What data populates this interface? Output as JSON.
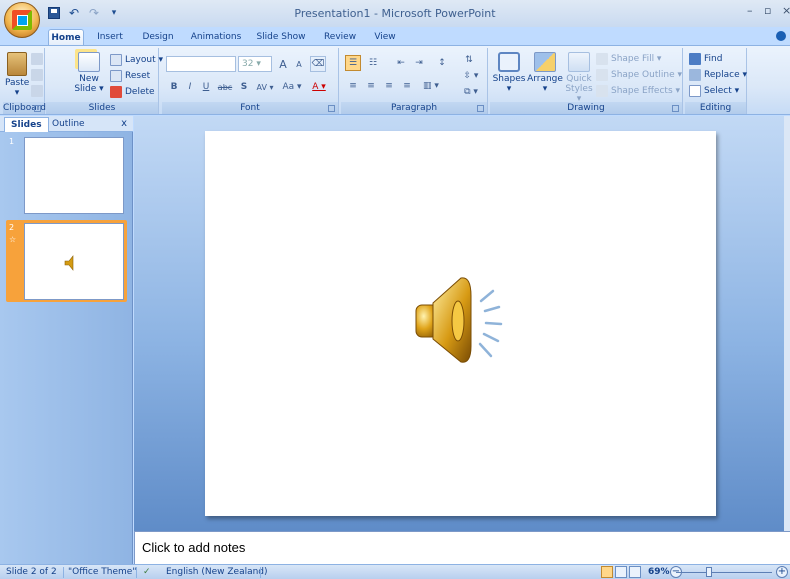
{
  "window": {
    "title": "Presentation1 - Microsoft PowerPoint",
    "minimize": "–",
    "maximize": "▫",
    "close": "×"
  },
  "quick_access": {
    "undo": "↶",
    "redo": "↷",
    "dropdown": "▾"
  },
  "tabs": [
    "Home",
    "Insert",
    "Design",
    "Animations",
    "Slide Show",
    "Review",
    "View"
  ],
  "active_tab": "Home",
  "ribbon": {
    "clipboard": {
      "label": "Clipboard",
      "paste": "Paste",
      "paste_arrow": "▾"
    },
    "slides": {
      "label": "Slides",
      "new_slide": "New",
      "new_slide_2": "Slide ▾",
      "layout": "Layout ▾",
      "reset": "Reset",
      "delete": "Delete"
    },
    "font": {
      "label": "Font",
      "font_size": "32",
      "grow": "A",
      "shrink": "A",
      "clear": "⌫",
      "bold": "B",
      "italic": "I",
      "underline": "U",
      "strike": "abc",
      "shadow": "S",
      "spacing": "AV ▾",
      "case": "Aa ▾",
      "color": "A ▾"
    },
    "paragraph": {
      "label": "Paragraph",
      "bullets": "☰",
      "numbering": "☷",
      "decrease_indent": "⇤",
      "increase_indent": "⇥",
      "line_spacing": "↕",
      "text_direction": "⇅",
      "align_left": "≡",
      "align_center": "≡",
      "align_right": "≡",
      "justify": "≡",
      "columns": "▥ ▾",
      "align_text": "⇳ ▾",
      "smartart": "⧉ ▾"
    },
    "drawing": {
      "label": "Drawing",
      "shapes": "Shapes",
      "shapes_arrow": "▾",
      "arrange": "Arrange",
      "arrange_arrow": "▾",
      "quick_styles": "Quick",
      "quick_styles_2": "Styles ▾",
      "shape_fill": "Shape Fill ▾",
      "shape_outline": "Shape Outline ▾",
      "shape_effects": "Shape Effects ▾"
    },
    "editing": {
      "label": "Editing",
      "find": "Find",
      "replace": "Replace ▾",
      "select": "Select ▾"
    }
  },
  "left_pane": {
    "tabs": [
      "Slides",
      "Outline"
    ],
    "close": "x",
    "slides": [
      {
        "number": "1"
      },
      {
        "number": "2",
        "marker": "☆"
      }
    ]
  },
  "notes": {
    "placeholder": "Click to add notes"
  },
  "status": {
    "slide_info": "Slide 2 of 2",
    "theme": "\"Office Theme\"",
    "language": "English (New Zealand)",
    "zoom": "69%",
    "zoom_level": 0.69,
    "zoom_out": "−",
    "zoom_in": "+"
  }
}
